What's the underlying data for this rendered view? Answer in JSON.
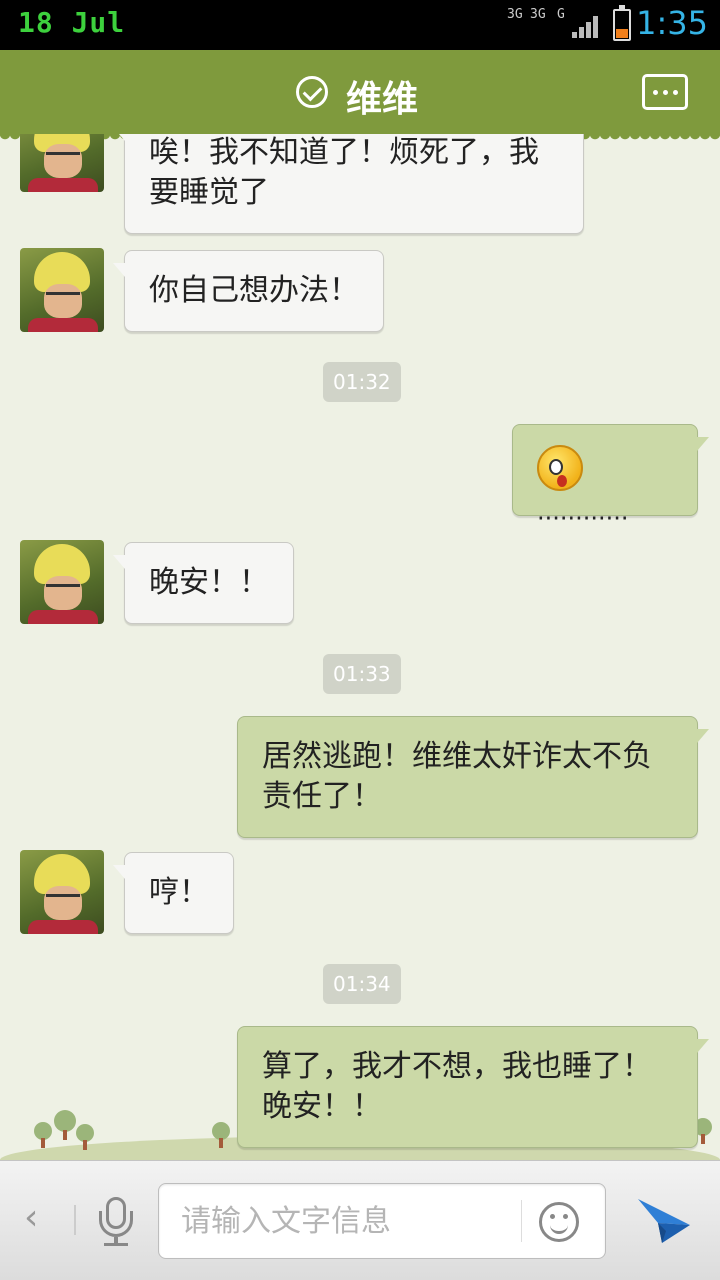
{
  "status_bar": {
    "date": "18 Jul",
    "network_1": "3G",
    "network_2": "3G",
    "network_3": "G",
    "time": "1:35",
    "battery_color": "#f07f1c",
    "time_color": "#35b4e6"
  },
  "header": {
    "title": "维维",
    "verified_icon": "check-circle-icon",
    "menu_icon": "more-dots-icon",
    "color": "#7f9a3d"
  },
  "messages": [
    {
      "side": "left",
      "text": "唉！我不知道了！烦死了，我要睡觉了"
    },
    {
      "side": "left",
      "text": "你自己想办法！"
    },
    {
      "type": "timestamp",
      "text": "01:32"
    },
    {
      "side": "right",
      "emoji": "shocked-face-emoji",
      "text": "............"
    },
    {
      "side": "left",
      "text": "晚安！！"
    },
    {
      "type": "timestamp",
      "text": "01:33"
    },
    {
      "side": "right",
      "text": "居然逃跑！维维太奸诈太不负责任了！"
    },
    {
      "side": "left",
      "text": "哼！"
    },
    {
      "type": "timestamp",
      "text": "01:34"
    },
    {
      "side": "right",
      "text": "算了，我才不想，我也睡了！晚安！！"
    }
  ],
  "input_bar": {
    "back_label": "‹",
    "placeholder": "请输入文字信息",
    "value": "",
    "mic_icon": "microphone-icon",
    "emoji_icon": "smiley-icon",
    "send_icon": "paper-plane-send-icon"
  }
}
